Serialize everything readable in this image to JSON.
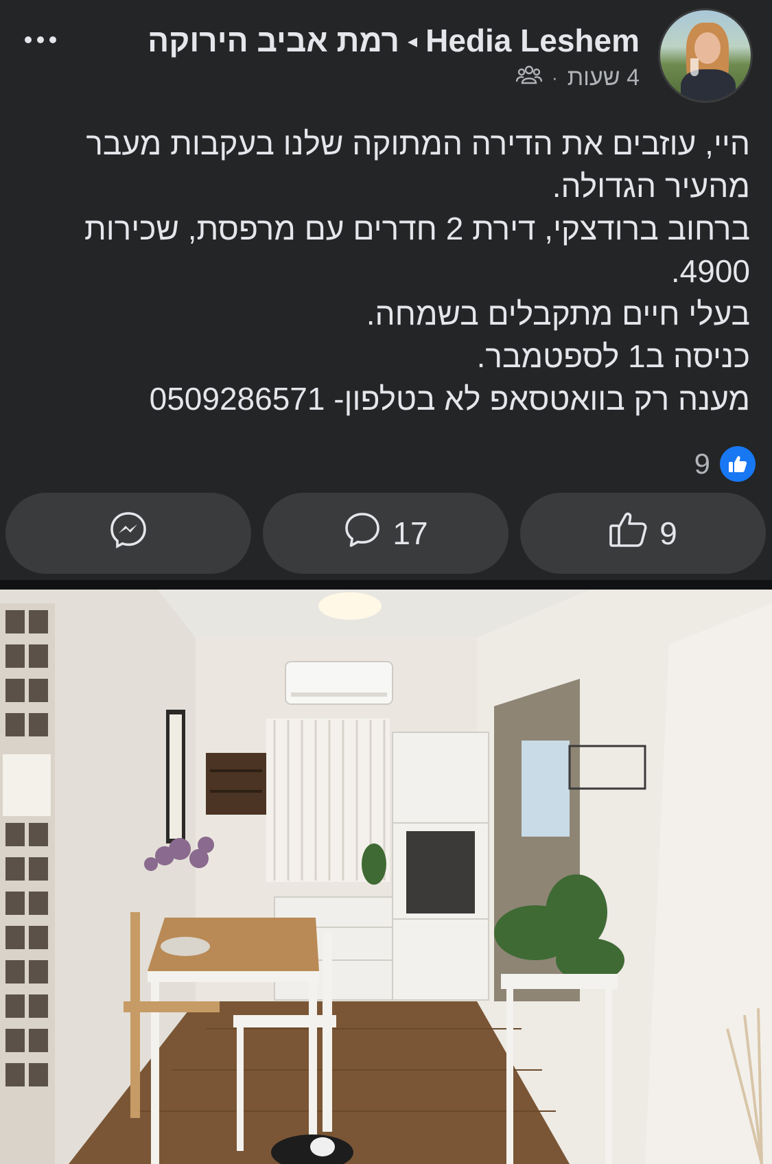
{
  "post": {
    "author": "Hedia Leshem",
    "group": "רמת אביב הירוקה",
    "separator": "◂",
    "time": "4 שעות",
    "audience_icon": "group-icon",
    "more_icon": "more-icon",
    "text_lines": [
      "היי, עוזבים את הדירה המתוקה שלנו בעקבות מעבר",
      "מהעיר הגדולה.",
      "ברחוב ברודצקי, דירת 2 חדרים עם מרפסת, שכירות",
      "4900.",
      "בעלי חיים מתקבלים בשמחה.",
      "כניסה ב1 לספטמבר.",
      "מענה רק בוואטסאפ לא בטלפון- 0509286571"
    ],
    "reactions": {
      "icon": "like-badge-icon",
      "count": "9"
    }
  },
  "actions": {
    "like": {
      "icon": "thumbs-up-icon",
      "count": "9"
    },
    "comment": {
      "icon": "comment-icon",
      "count": "17"
    },
    "share": {
      "icon": "messenger-icon"
    }
  },
  "colors": {
    "background": "#242526",
    "button": "#3a3b3c",
    "text": "#e4e6eb",
    "secondary_text": "#b0b3b8",
    "accent": "#1877f2"
  }
}
